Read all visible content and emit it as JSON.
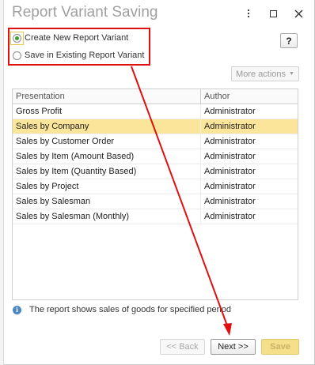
{
  "window": {
    "title": "Report Variant Saving",
    "menu_icon": "more-vertical-icon",
    "maximize_icon": "maximize-icon",
    "close_icon": "close-icon"
  },
  "help": {
    "label": "?"
  },
  "options": [
    {
      "label": "Create New Report Variant",
      "checked": true
    },
    {
      "label": "Save in Existing Report Variant",
      "checked": false
    }
  ],
  "more_actions": {
    "label": "More actions"
  },
  "table": {
    "columns": [
      "Presentation",
      "Author"
    ],
    "rows": [
      {
        "presentation": "Gross Profit",
        "author": "Administrator",
        "selected": false
      },
      {
        "presentation": "Sales by Company",
        "author": "Administrator",
        "selected": true
      },
      {
        "presentation": "Sales by Customer Order",
        "author": "Administrator",
        "selected": false
      },
      {
        "presentation": "Sales by Item (Amount Based)",
        "author": "Administrator",
        "selected": false
      },
      {
        "presentation": "Sales by Item (Quantity Based)",
        "author": "Administrator",
        "selected": false
      },
      {
        "presentation": "Sales by Project",
        "author": "Administrator",
        "selected": false
      },
      {
        "presentation": "Sales by Salesman",
        "author": "Administrator",
        "selected": false
      },
      {
        "presentation": "Sales by Salesman (Monthly)",
        "author": "Administrator",
        "selected": false
      }
    ]
  },
  "info": {
    "text": "The report shows sales of goods for specified period"
  },
  "buttons": {
    "back": "<< Back",
    "next": "Next >>",
    "save": "Save"
  },
  "colors": {
    "annotation": "#e01010",
    "selected_row": "#fbe59a",
    "save_button": "#f6df8a"
  }
}
